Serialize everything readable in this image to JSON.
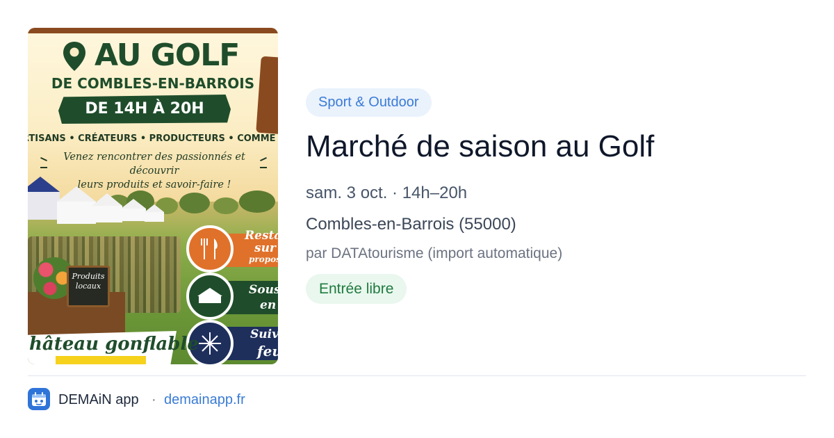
{
  "poster": {
    "heading": "AU GOLF",
    "place": "DE COMBLES-EN-BARROIS",
    "hours": "DE 14H À 20H",
    "trades": "RTISANS  •  CRÉATEURS  •  PRODUCTEURS  •  COMME",
    "tagline_line1": "Venez rencontrer des passionnés et découvrir",
    "tagline_line2": "leurs produits et savoir-faire !",
    "chalkboard": "Produits locaux",
    "band1": "Restau",
    "band1b": "sur",
    "band1c": "proposé",
    "band2": "Sous",
    "band2b": "en",
    "band3": "Suivi",
    "band3b": "feu",
    "banner": "hâteau gonflable",
    "colors": {
      "green": "#1f4d2b",
      "orange": "#e0712a",
      "navy": "#1e2f5c"
    }
  },
  "event": {
    "category": "Sport & Outdoor",
    "title": "Marché de saison au Golf",
    "datetime": "sam. 3 oct. · 14h–20h",
    "location": "Combles-en-Barrois (55000)",
    "organizer": "par DATAtourisme (import automatique)",
    "price": "Entrée libre"
  },
  "footer": {
    "app_name": "DEMAiN app",
    "separator": "·",
    "url": "demainapp.fr",
    "icon": "app-logo-icon"
  },
  "colors": {
    "accent": "#3a7bd5",
    "category_bg": "#eaf2fc",
    "price_bg": "#e9f7ee",
    "price_text": "#1f7a3e"
  }
}
